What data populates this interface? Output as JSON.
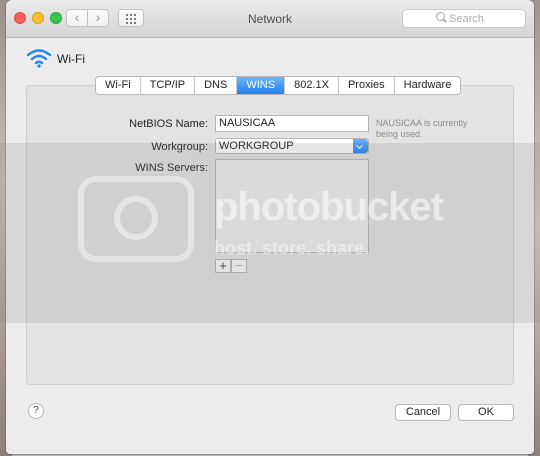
{
  "window": {
    "title": "Network"
  },
  "search": {
    "placeholder": "Search"
  },
  "interface": {
    "name": "Wi-Fi"
  },
  "tabs": [
    {
      "label": "Wi-Fi",
      "active": false
    },
    {
      "label": "TCP/IP",
      "active": false
    },
    {
      "label": "DNS",
      "active": false
    },
    {
      "label": "WINS",
      "active": true
    },
    {
      "label": "802.1X",
      "active": false
    },
    {
      "label": "Proxies",
      "active": false
    },
    {
      "label": "Hardware",
      "active": false
    }
  ],
  "wins": {
    "netbios_label": "NetBIOS Name:",
    "netbios_value": "NAUSICAA",
    "netbios_hint": "NAUSICAA is currently being used.",
    "workgroup_label": "Workgroup:",
    "workgroup_value": "WORKGROUP",
    "servers_label": "WINS Servers:",
    "add_symbol": "+",
    "remove_symbol": "−"
  },
  "footer": {
    "help_symbol": "?",
    "cancel_label": "Cancel",
    "ok_label": "OK"
  },
  "watermark": {
    "title": "photobucket",
    "subtitle": "host. store. share."
  },
  "colors": {
    "accent": "#1f83f1",
    "close": "#fc5f57",
    "minimize": "#fdbc2e",
    "maximize": "#33c748"
  },
  "icons": [
    "wifi-icon",
    "back-icon",
    "forward-icon",
    "grid-icon",
    "search-icon",
    "help-icon",
    "chevron-down-icon"
  ]
}
